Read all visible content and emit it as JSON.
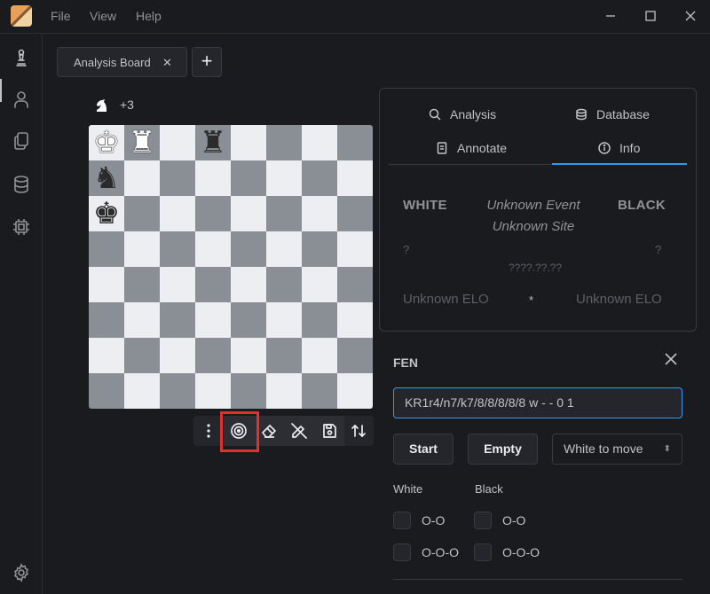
{
  "menu": {
    "file": "File",
    "view": "View",
    "help": "Help"
  },
  "window": {
    "minimize_icon": "minimize-icon",
    "maximize_icon": "maximize-icon",
    "close_icon": "close-icon"
  },
  "sidebar": {
    "items": [
      {
        "name": "board",
        "icon": "chess-pawn-icon",
        "active": true
      },
      {
        "name": "user",
        "icon": "user-icon"
      },
      {
        "name": "files",
        "icon": "files-icon"
      },
      {
        "name": "database",
        "icon": "database-icon"
      },
      {
        "name": "engines",
        "icon": "cpu-icon"
      }
    ],
    "settings_icon": "gear-icon"
  },
  "tabs": [
    {
      "label": "Analysis Board",
      "close": "✕"
    }
  ],
  "add_tab": "+",
  "material": {
    "icon": "white-knight-icon",
    "text": "+3"
  },
  "board": {
    "pieces": [
      {
        "square": "a8",
        "glyph": "♚",
        "color": "w"
      },
      {
        "square": "b8",
        "glyph": "♜",
        "color": "w"
      },
      {
        "square": "d8",
        "glyph": "♜",
        "color": "b"
      },
      {
        "square": "a7",
        "glyph": "♞",
        "color": "b"
      },
      {
        "square": "a6",
        "glyph": "♚",
        "color": "b"
      }
    ],
    "light_color": "#eceef1",
    "dark_color": "#8a8f96"
  },
  "board_toolbar": [
    {
      "name": "more-options",
      "icon": "dots-vertical-icon"
    },
    {
      "name": "target",
      "icon": "target-icon"
    },
    {
      "name": "eraser",
      "icon": "eraser-icon"
    },
    {
      "name": "edit-off",
      "icon": "pencil-off-icon"
    },
    {
      "name": "save",
      "icon": "save-icon"
    },
    {
      "name": "flip",
      "icon": "arrows-up-down-icon"
    }
  ],
  "panel": {
    "tabs": [
      {
        "label": "Analysis",
        "icon": "zoom-icon"
      },
      {
        "label": "Database",
        "icon": "database-icon"
      },
      {
        "label": "Annotate",
        "icon": "notes-icon"
      },
      {
        "label": "Info",
        "icon": "info-circle-icon",
        "active": true
      }
    ],
    "info": {
      "white": "WHITE",
      "black": "BLACK",
      "event": "Unknown Event",
      "site": "Unknown Site",
      "white_player": "?",
      "black_player": "?",
      "date": "????.??.??",
      "white_elo": "Unknown ELO",
      "black_elo": "Unknown ELO",
      "result": "*"
    }
  },
  "fen": {
    "title": "FEN",
    "value": "KR1r4/n7/k7/8/8/8/8/8 w - - 0 1",
    "start_button": "Start",
    "empty_button": "Empty",
    "turn_select": "White to move",
    "castling": {
      "white_header": "White",
      "black_header": "Black",
      "short": "O-O",
      "long": "O-O-O"
    }
  },
  "accent_color": "#339af0",
  "highlight_color": "#e03131"
}
